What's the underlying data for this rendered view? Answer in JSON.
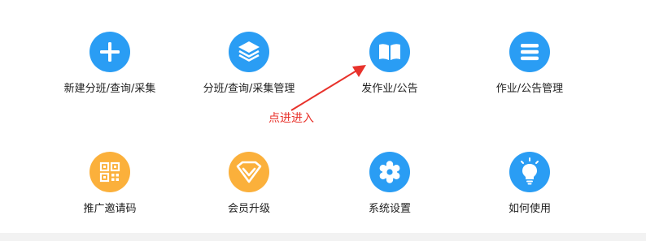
{
  "colors": {
    "blue": "#2a9df4",
    "orange": "#fbb03b",
    "annotation": "#e8322b",
    "text": "#222222"
  },
  "menu": {
    "row1": [
      {
        "label": "新建分班/查询/采集",
        "icon": "plus-icon",
        "color": "#2a9df4"
      },
      {
        "label": "分班/查询/采集管理",
        "icon": "layers-icon",
        "color": "#2a9df4"
      },
      {
        "label": "发作业/公告",
        "icon": "book-icon",
        "color": "#2a9df4"
      },
      {
        "label": "作业/公告管理",
        "icon": "list-icon",
        "color": "#2a9df4"
      }
    ],
    "row2": [
      {
        "label": "推广邀请码",
        "icon": "qr-code-icon",
        "color": "#fbb03b"
      },
      {
        "label": "会员升级",
        "icon": "diamond-icon",
        "color": "#fbb03b"
      },
      {
        "label": "系统设置",
        "icon": "gear-icon",
        "color": "#2a9df4"
      },
      {
        "label": "如何使用",
        "icon": "lightbulb-icon",
        "color": "#2a9df4"
      }
    ]
  },
  "annotation": {
    "text": "点进进入"
  }
}
